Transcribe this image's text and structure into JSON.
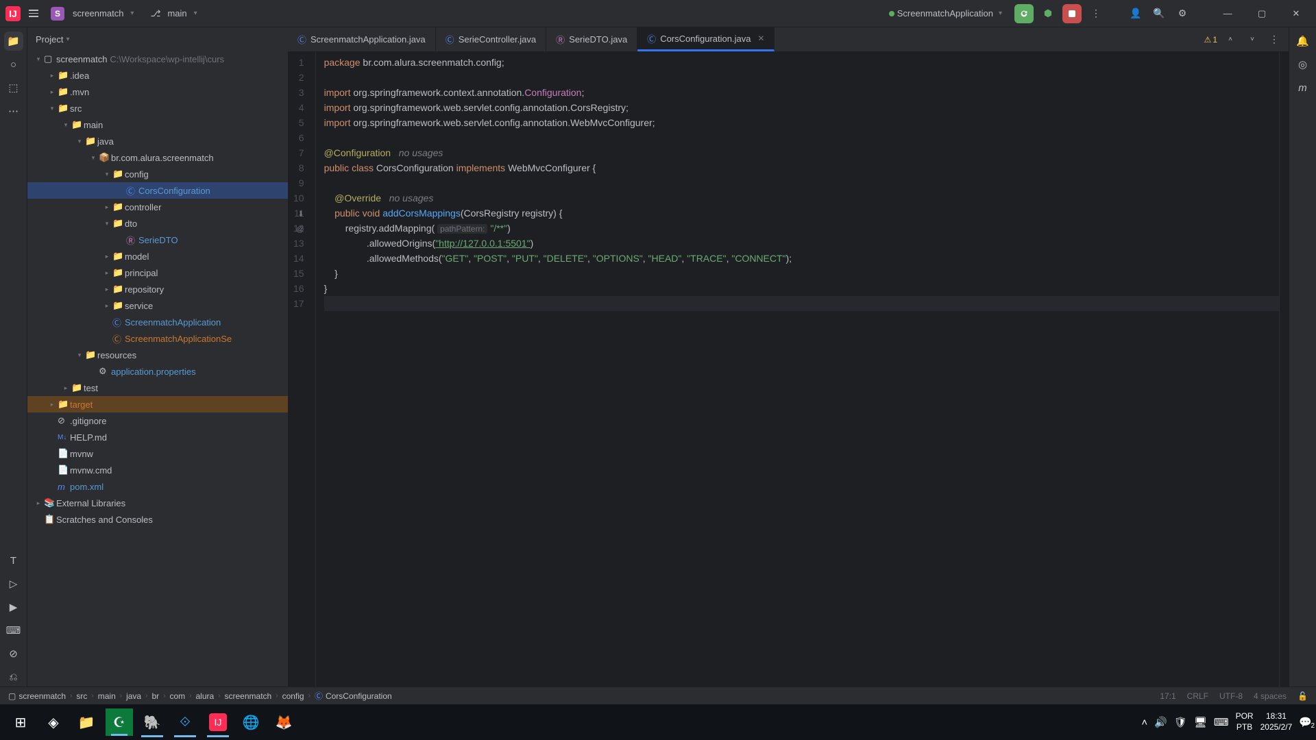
{
  "titlebar": {
    "project_name": "screenmatch",
    "branch": "main",
    "run_config": "ScreenmatchApplication"
  },
  "panel": {
    "title": "Project"
  },
  "tree": {
    "root": "screenmatch",
    "root_path": "C:\\Workspace\\wp-intellij\\curs",
    "idea": ".idea",
    "mvn": ".mvn",
    "src": "src",
    "main": "main",
    "java": "java",
    "pkg": "br.com.alura.screenmatch",
    "config": "config",
    "cors": "CorsConfiguration",
    "controller": "controller",
    "dto": "dto",
    "seriedto": "SerieDTO",
    "model": "model",
    "principal": "principal",
    "repository": "repository",
    "service": "service",
    "app": "ScreenmatchApplication",
    "appse": "ScreenmatchApplicationSe",
    "resources": "resources",
    "appprops": "application.properties",
    "test": "test",
    "target": "target",
    "gitignore": ".gitignore",
    "help": "HELP.md",
    "mvnw": "mvnw",
    "mvnwcmd": "mvnw.cmd",
    "pom": "pom.xml",
    "extlib": "External Libraries",
    "scratch": "Scratches and Consoles"
  },
  "tabs": {
    "t1": "ScreenmatchApplication.java",
    "t2": "SerieController.java",
    "t3": "SerieDTO.java",
    "t4": "CorsConfiguration.java"
  },
  "warnings": "1",
  "code": {
    "l1_pkg": "package",
    "l1_rest": " br.com.alura.screenmatch.config;",
    "l3_imp": "import",
    "l3_mid": " org.springframework.context.annotation.",
    "l3_cfg": "Configuration",
    "l3_end": ";",
    "l4_imp": "import",
    "l4_rest": " org.springframework.web.servlet.config.annotation.CorsRegistry;",
    "l5_imp": "import",
    "l5_rest": " org.springframework.web.servlet.config.annotation.WebMvcConfigurer;",
    "l7_ann": "@Configuration",
    "l7_hint": "no usages",
    "l8_pub": "public",
    "l8_cls": "class",
    "l8_name": " CorsConfiguration ",
    "l8_impl": "implements",
    "l8_iface": " WebMvcConfigurer {",
    "l10_ann": "@Override",
    "l10_hint": "no usages",
    "l11_pub": "public",
    "l11_void": "void",
    "l11_fn": "addCorsMappings",
    "l11_sig": "(CorsRegistry registry) {",
    "l12_pre": "        registry.addMapping(",
    "l12_hint": "pathPattern:",
    "l12_str": " \"/**\"",
    "l12_end": ")",
    "l13_pre": "                .allowedOrigins(",
    "l13_url": "\"http://127.0.0.1:5501\"",
    "l13_end": ")",
    "l14_pre": "                .allowedMethods(",
    "l14_s1": "\"GET\"",
    "l14_s2": "\"POST\"",
    "l14_s3": "\"PUT\"",
    "l14_s4": "\"DELETE\"",
    "l14_s5": "\"OPTIONS\"",
    "l14_s6": "\"HEAD\"",
    "l14_s7": "\"TRACE\"",
    "l14_s8": "\"CONNECT\"",
    "l14_end": ");",
    "l15": "    }",
    "l16": "}"
  },
  "breadcrumb": {
    "b1": "screenmatch",
    "b2": "src",
    "b3": "main",
    "b4": "java",
    "b5": "br",
    "b6": "com",
    "b7": "alura",
    "b8": "screenmatch",
    "b9": "config",
    "b10": "CorsConfiguration"
  },
  "status": {
    "pos": "17:1",
    "eol": "CRLF",
    "enc": "UTF-8",
    "indent": "4 spaces"
  },
  "taskbar": {
    "lang1": "POR",
    "lang2": "PTB",
    "time": "18:31",
    "date": "2025/2/7",
    "notif": "2"
  }
}
